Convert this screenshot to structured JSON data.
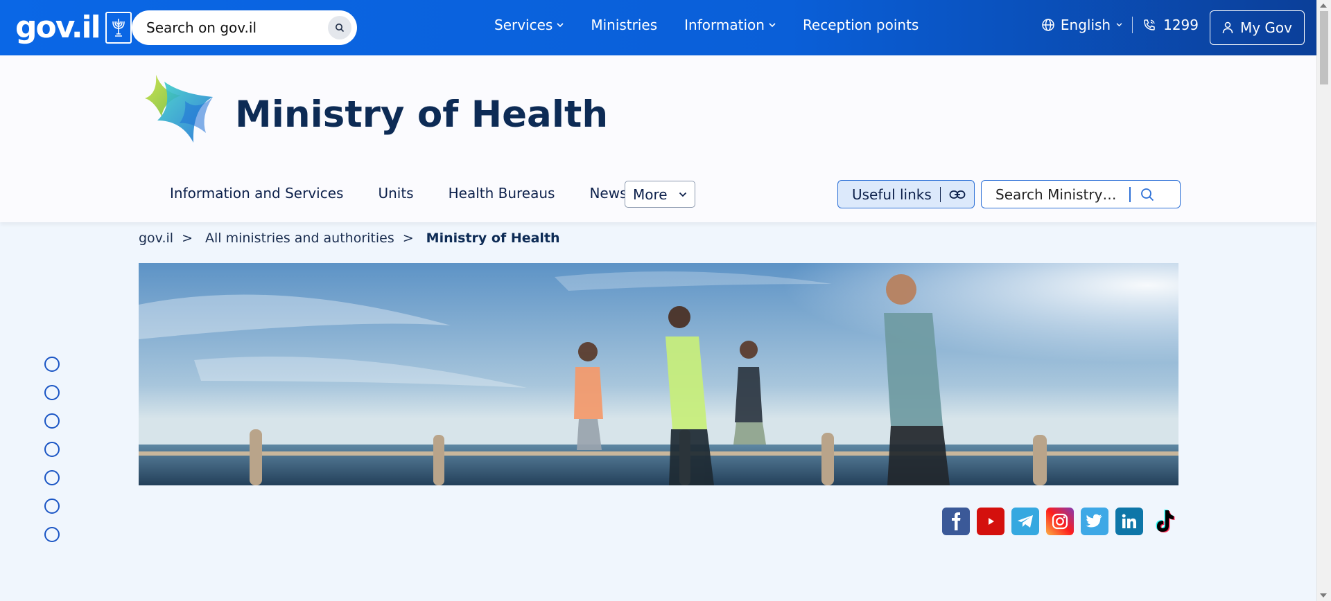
{
  "topbar": {
    "logo_text": "gov.il",
    "search_placeholder": "Search on gov.il",
    "nav": [
      {
        "label": "Services",
        "has_dropdown": true
      },
      {
        "label": "Ministries",
        "has_dropdown": false
      },
      {
        "label": "Information",
        "has_dropdown": true
      },
      {
        "label": "Reception points",
        "has_dropdown": false
      }
    ],
    "language": "English",
    "phone": "1299",
    "my_gov": "My Gov"
  },
  "ministry": {
    "title": "Ministry of Health",
    "subnav": [
      "Information and Services",
      "Units",
      "Health Bureaus",
      "News"
    ],
    "more_label": "More",
    "useful_links_label": "Useful links",
    "search_placeholder": "Search Ministry o..."
  },
  "breadcrumb": {
    "items": [
      "gov.il",
      "All ministries and authorities"
    ],
    "separator": ">",
    "current": "Ministry of Health"
  },
  "side_dots": 7,
  "social": [
    "facebook-icon",
    "youtube-icon",
    "telegram-icon",
    "instagram-icon",
    "twitter-icon",
    "linkedin-icon",
    "tiktok-icon"
  ],
  "colors": {
    "header_blue": "#0a67e6",
    "title_navy": "#0d2b55",
    "accent_blue": "#2b6fd6",
    "page_bg": "#f0f6fd"
  }
}
